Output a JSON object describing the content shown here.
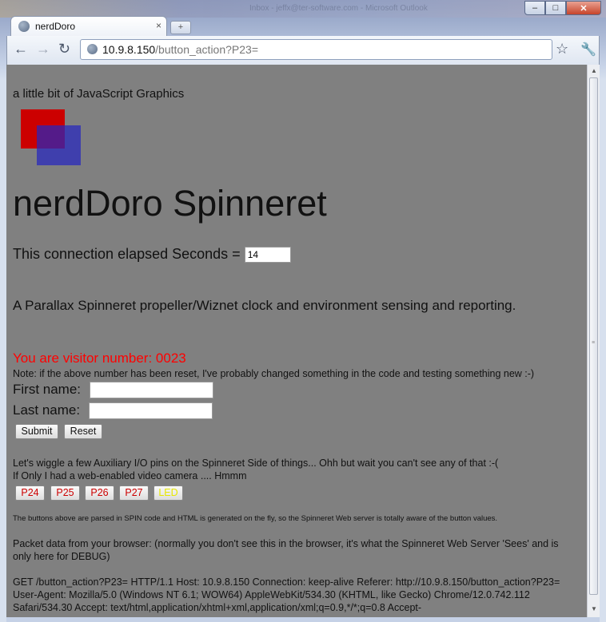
{
  "browser": {
    "tab_title": "nerdDoro",
    "tab_close": "×",
    "new_tab": "+",
    "url_host": "10.9.8.150",
    "url_path": "/button_action?P23=",
    "back": "←",
    "forward": "→",
    "reload": "↻",
    "star": "☆",
    "wrench": "🔧",
    "window": {
      "minimize": "–",
      "maximize": "□",
      "close": "✕"
    },
    "desktop_text": "Inbox - jeffx@ter-software.com - Microsoft Outlook",
    "scroll_up": "▲",
    "scroll_down": "▼"
  },
  "page": {
    "tagline": "a little bit of JavaScript Graphics",
    "heading": "nerdDoro Spinneret",
    "elapsed_label": "This connection elapsed Seconds =",
    "elapsed_value": "14",
    "description": "A Parallax Spinneret propeller/Wiznet clock and environment sensing and reporting.",
    "visitor": "You are visitor number: 0023",
    "note": "Note: if the above number has been reset, I've probably changed something in the code and testing something new :-)",
    "first_name_label": "First name:",
    "last_name_label": "Last name:",
    "first_name_value": "",
    "last_name_value": "",
    "submit": "Submit",
    "reset": "Reset",
    "wiggle_line1": "Let's wiggle a few Auxiliary I/O pins on the Spinneret Side of things... Ohh but wait you can't see any of that :-(",
    "wiggle_line2": "If Only I had a web-enabled video camera .... Hmmm",
    "pin_buttons": [
      "P24",
      "P25",
      "P26",
      "P27",
      "LED"
    ],
    "small_note": "The buttons above are parsed in SPIN code and HTML is generated on the fly, so the Spinneret Web server is totally aware of the button values.",
    "packet_intro": "Packet data from your browser: (normally you don't see this in the browser, it's what the Spinneret Web Server 'Sees' and is only here for DEBUG)",
    "get_request": "GET /button_action?P23= HTTP/1.1 Host: 10.9.8.150 Connection: keep-alive Referer: http://10.9.8.150/button_action?P23= User-Agent: Mozilla/5.0 (Windows NT 6.1; WOW64) AppleWebKit/534.30 (KHTML, like Gecko) Chrome/12.0.742.112 Safari/534.30 Accept: text/html,application/xhtml+xml,application/xml;q=0.9,*/*;q=0.8 Accept-"
  },
  "colors": {
    "page_bg": "#808080",
    "visitor_text": "#ff0000",
    "pin_button_text": "#cc0000",
    "led_button_text": "#e8e800",
    "square_red": "#cc0000",
    "square_blue": "#2626be"
  }
}
